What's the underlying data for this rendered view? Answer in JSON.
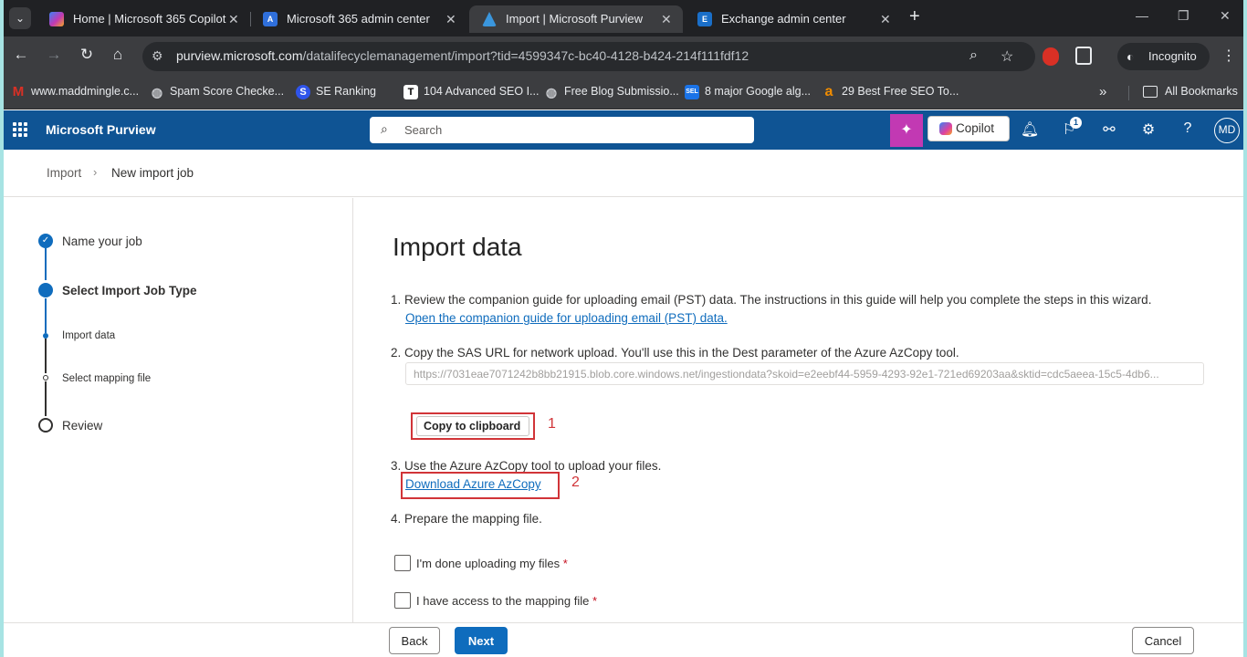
{
  "browser": {
    "tabs": [
      {
        "title": "Home | Microsoft 365 Copilot",
        "active": false,
        "favicon_color": "#7b5cf0"
      },
      {
        "title": "Microsoft 365 admin center",
        "active": false,
        "favicon_color": "#2f6fdb"
      },
      {
        "title": "Import | Microsoft Purview",
        "active": true,
        "favicon_color": "#3a96dd"
      },
      {
        "title": "Exchange admin center",
        "active": false,
        "favicon_color": "#1a6fc9"
      }
    ],
    "url_host": "purview.microsoft.com",
    "url_path": "/datalifecyclemanagement/import?tid=4599347c-bc40-4128-b424-214f111fdf12",
    "incognito_label": "Incognito",
    "bookmarks": [
      {
        "label": "www.maddmingle.c...",
        "icon": "M",
        "color": "#d93025"
      },
      {
        "label": "Spam Score Checke...",
        "icon": "globe",
        "color": "#9aa0a6"
      },
      {
        "label": "SE Ranking",
        "icon": "se",
        "color": "#2f54eb"
      },
      {
        "label": "104 Advanced SEO I...",
        "icon": "T",
        "color": "#ffffff"
      },
      {
        "label": "Free Blog Submissio...",
        "icon": "globe",
        "color": "#9aa0a6"
      },
      {
        "label": "8 major Google alg...",
        "icon": "SEL",
        "color": "#1a73e8"
      },
      {
        "label": "29 Best Free SEO To...",
        "icon": "a",
        "color": "#f08c00"
      }
    ],
    "all_bookmarks_label": "All Bookmarks"
  },
  "app": {
    "name": "Microsoft Purview",
    "search_placeholder": "Search",
    "copilot_label": "Copilot",
    "notification_count": "1",
    "avatar_initials": "MD"
  },
  "breadcrumb": {
    "items": [
      "Import",
      "New import job"
    ]
  },
  "steps": [
    {
      "label": "Name your job",
      "state": "done"
    },
    {
      "label": "Select Import Job Type",
      "state": "current"
    },
    {
      "label": "Import data",
      "state": "current-sub"
    },
    {
      "label": "Select mapping file",
      "state": "pending-sub"
    },
    {
      "label": "Review",
      "state": "pending"
    }
  ],
  "main": {
    "title": "Import data",
    "step1_text": "1. Review the companion guide for uploading email (PST) data. The instructions in this guide will help you complete the steps in this wizard.",
    "step1_link": "Open the companion guide for uploading email (PST) data.",
    "step2_text": "2. Copy the SAS URL for network upload. You'll use this in the Dest parameter of the Azure AzCopy tool.",
    "sas_url": "https://7031eae7071242b8bb21915.blob.core.windows.net/ingestiondata?skoid=e2eebf44-5959-4293-92e1-721ed69203aa&sktid=cdc5aeea-15c5-4db6...",
    "copy_button": "Copy to clipboard",
    "marker1": "1",
    "step3_text": "3. Use the Azure AzCopy tool to upload your files.",
    "step3_link": "Download Azure AzCopy",
    "marker2": "2",
    "step4_text": "4. Prepare the mapping file.",
    "checkbox1_label": "I'm done uploading my files",
    "checkbox2_label": "I have access to the mapping file",
    "required_mark": "*"
  },
  "footer": {
    "back": "Back",
    "next": "Next",
    "cancel": "Cancel"
  },
  "colors": {
    "appbar": "#0f5494",
    "accent": "#0f6cbd",
    "highlight_box": "#d13438"
  }
}
